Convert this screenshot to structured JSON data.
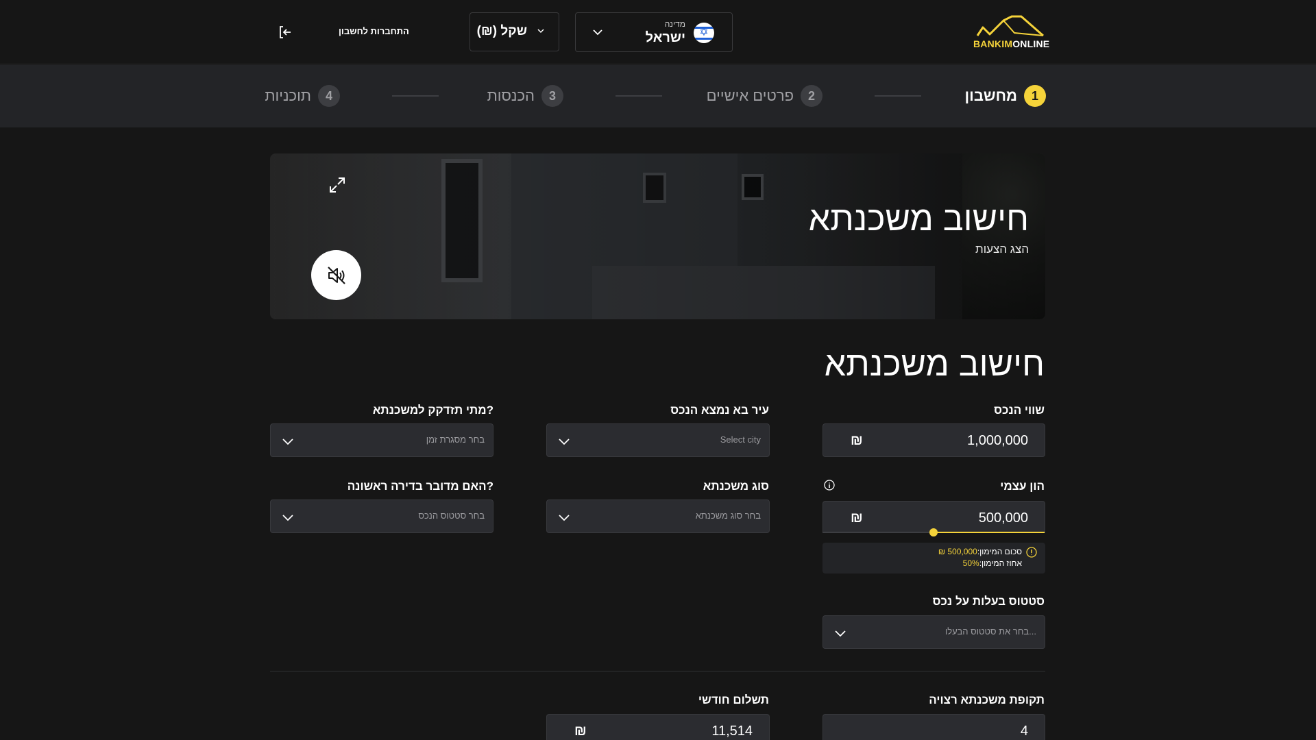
{
  "header": {
    "logo": {
      "part1": "BANKIM",
      "part2": "ONLINE"
    },
    "country": {
      "label": "מדינה",
      "value": "ישראל"
    },
    "currency": {
      "value": "(₪) שקל"
    },
    "login_label": "התחברות לחשבון"
  },
  "stepper": {
    "steps": [
      {
        "num": "1",
        "label": "מחשבון",
        "active": true
      },
      {
        "num": "2",
        "label": "פרטים אישיים",
        "active": false
      },
      {
        "num": "3",
        "label": "הכנסות",
        "active": false
      },
      {
        "num": "4",
        "label": "תוכניות",
        "active": false
      }
    ]
  },
  "hero": {
    "title": "חישוב משכנתא",
    "subtitle": "הצג הצעות"
  },
  "form": {
    "title": "חישוב משכנתא",
    "property_value": {
      "label": "שווי הנכס",
      "value": "1,000,000",
      "currency": "₪"
    },
    "city": {
      "label": "עיר בא נמצא הנכס",
      "placeholder": "Select city"
    },
    "timeframe": {
      "label": "מתי תזדקק למשכנתא?",
      "placeholder": "בחר מסגרת זמן"
    },
    "equity": {
      "label": "הון עצמי",
      "value": "500,000",
      "currency": "₪",
      "slider_fraction": 0.5,
      "min_amount_label": "סכום המימון:",
      "min_amount_value": "500,000 ₪",
      "percent_label": "אחוז המימון:",
      "percent_value": "50%"
    },
    "mortgage_type": {
      "label": "סוג משכנתא",
      "placeholder": "בחר סוג משכנתא"
    },
    "first_apartment": {
      "label": "האם מדובר בדירה ראשונה?",
      "placeholder": "בחר סטטוס הנכס"
    },
    "ownership_status": {
      "label": "סטטוס בעלות על נכס",
      "placeholder": "בחר את סטטוס הבעלו..."
    },
    "period": {
      "label": "תקופת משכנתא רצויה",
      "value": "4"
    },
    "monthly_payment": {
      "label": "תשלום חודשי",
      "value": "11,514",
      "currency": "₪"
    }
  },
  "colors": {
    "background": "#161616",
    "accent": "#f5d33a",
    "field_bg": "#2b2c30",
    "stepper_bg": "#232427"
  }
}
